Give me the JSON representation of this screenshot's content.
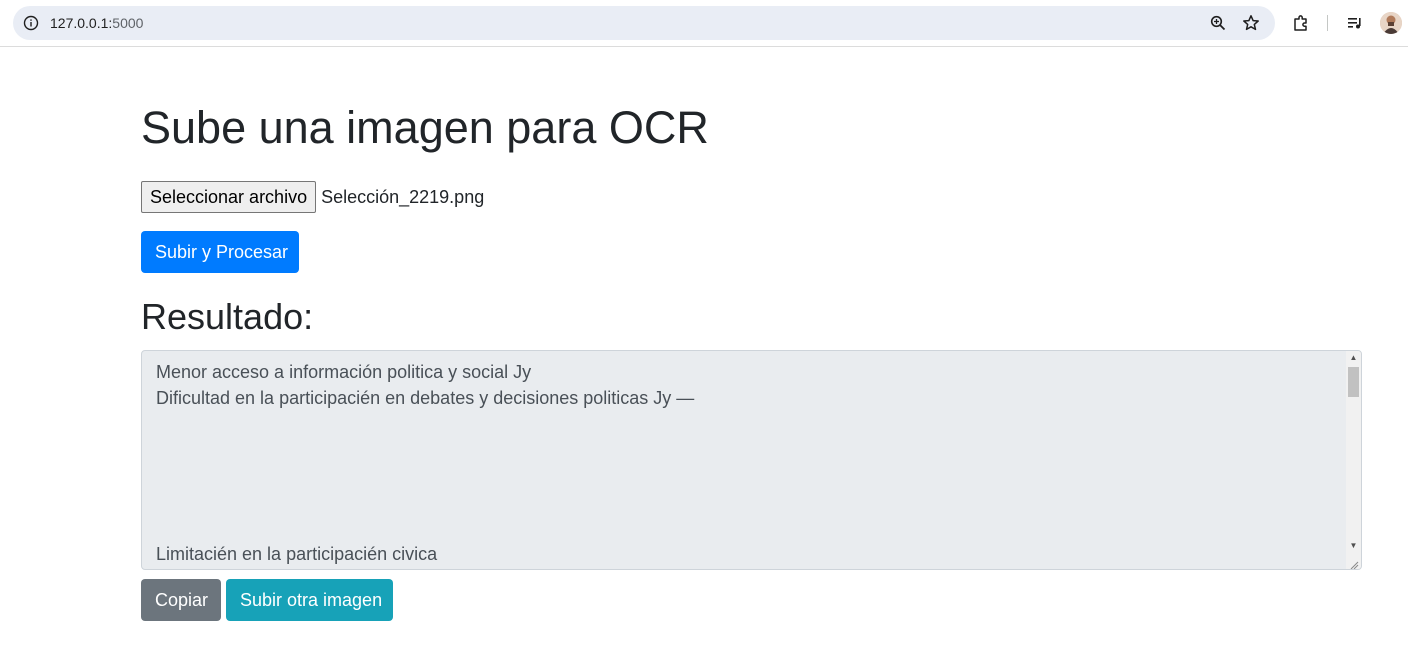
{
  "browser": {
    "url_host": "127.0.0.1:",
    "url_port": "5000",
    "icons": [
      "info-icon",
      "zoom-icon",
      "star-icon",
      "extensions-icon",
      "media-control-icon",
      "avatar"
    ]
  },
  "page": {
    "title": "Sube una imagen para OCR",
    "file_input": {
      "button_label": "Seleccionar archivo",
      "file_name": "Selección_2219.png"
    },
    "submit_label": "Subir y Procesar",
    "result_heading": "Resultado:",
    "result_text": "Menor acceso a información politica y social Jy\nDificultad en la participacién en debates y decisiones politicas Jy —\n\n\n\n\n\nLimitacién en la participacién civica",
    "copy_label": "Copiar",
    "upload_another_label": "Subir otra imagen"
  },
  "colors": {
    "primary": "#007bff",
    "secondary": "#6c757d",
    "info": "#17a2b8",
    "textarea_bg": "#e9ecef"
  }
}
